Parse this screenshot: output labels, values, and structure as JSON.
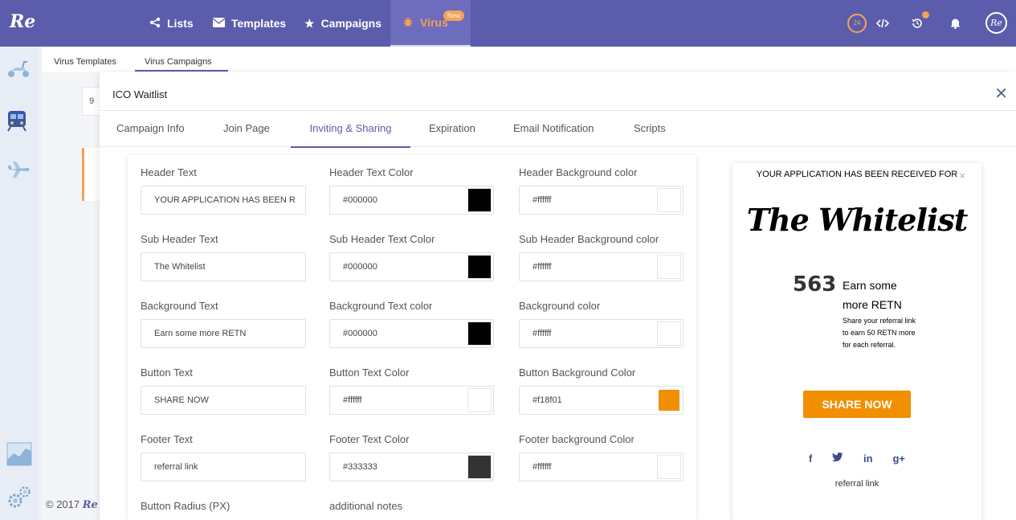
{
  "brand": {
    "logo_text": "Re",
    "accent": "#5b5cab",
    "highlight": "#f5a259"
  },
  "topnav": {
    "items": [
      {
        "label": "Lists",
        "icon": "share-icon"
      },
      {
        "label": "Templates",
        "icon": "envelope-icon"
      },
      {
        "label": "Campaigns",
        "icon": "star-icon"
      },
      {
        "label": "Virus",
        "icon": "bug-icon",
        "badge": "New"
      }
    ],
    "timer_label": "24",
    "avatar_text": "Re"
  },
  "sidebar": {
    "icons": [
      "scooter-icon",
      "train-icon",
      "plane-icon",
      "chart-area-icon",
      "settings-gears-icon"
    ]
  },
  "subtabs": [
    "Virus Templates",
    "Virus Campaigns"
  ],
  "background": {
    "cell_text": "9",
    "footer": "© 2017",
    "footer_logo": "Re"
  },
  "modal": {
    "title": "ICO Waitlist",
    "tabs": [
      "Campaign Info",
      "Join Page",
      "Inviting & Sharing",
      "Expiration",
      "Email Notification",
      "Scripts"
    ],
    "active_tab": "Inviting & Sharing"
  },
  "form": {
    "header_text": {
      "label": "Header Text",
      "value": "YOUR APPLICATION HAS BEEN R"
    },
    "header_text_color": {
      "label": "Header Text Color",
      "value": "#000000",
      "swatch": "#000000"
    },
    "header_bg_color": {
      "label": "Header Background color",
      "value": "#ffffff",
      "swatch": "#ffffff"
    },
    "sub_header_text": {
      "label": "Sub Header Text",
      "value": "The Whitelist"
    },
    "sub_header_text_color": {
      "label": "Sub Header Text Color",
      "value": "#000000",
      "swatch": "#000000"
    },
    "sub_header_bg_color": {
      "label": "Sub Header Background color",
      "value": "#ffffff",
      "swatch": "#ffffff"
    },
    "background_text": {
      "label": "Background Text",
      "value": "Earn some more RETN"
    },
    "background_text_color": {
      "label": "Background Text color",
      "value": "#000000",
      "swatch": "#000000"
    },
    "background_color": {
      "label": "Background color",
      "value": "#ffffff",
      "swatch": "#ffffff"
    },
    "button_text": {
      "label": "Button Text",
      "value": "SHARE NOW"
    },
    "button_text_color": {
      "label": "Button Text Color",
      "value": "#ffffff",
      "swatch": "#ffffff"
    },
    "button_bg_color": {
      "label": "Button Background Color",
      "value": "#f18f01",
      "swatch": "#f18f01"
    },
    "footer_text": {
      "label": "Footer Text",
      "value": "referral link"
    },
    "footer_text_color": {
      "label": "Footer Text Color",
      "value": "#333333",
      "swatch": "#333333"
    },
    "footer_bg_color": {
      "label": "Footer background Color",
      "value": "#ffffff",
      "swatch": "#ffffff"
    },
    "button_radius": {
      "label": "Button Radius (PX)"
    },
    "additional_notes": {
      "label": "additional notes"
    }
  },
  "preview": {
    "header": "YOUR APPLICATION HAS BEEN RECEIVED FOR",
    "close": "×",
    "sub_header": "The Whitelist",
    "count": "563",
    "bg_text": "Earn some more RETN",
    "note": "Share your referral link to earn 50 RETN more for each referral.",
    "button": "SHARE NOW",
    "social": [
      "f",
      "t",
      "in",
      "g+"
    ],
    "footer": "referral link"
  }
}
